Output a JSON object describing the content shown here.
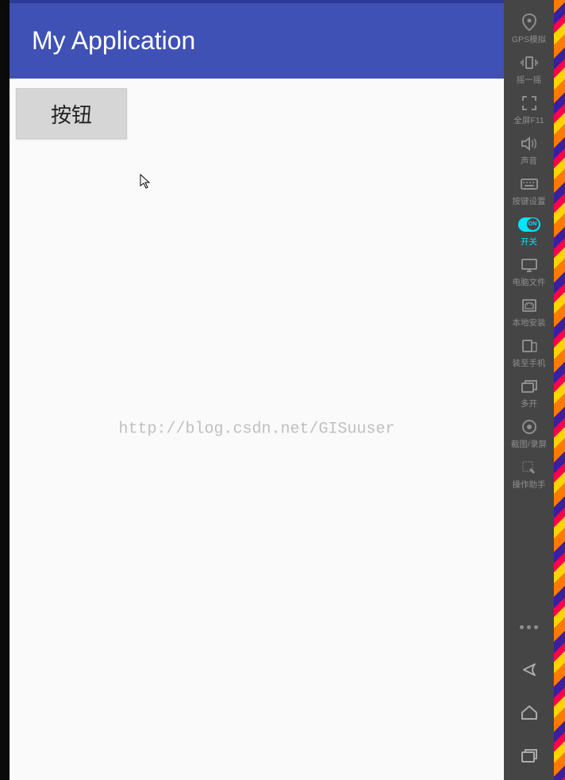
{
  "app": {
    "title": "My Application",
    "button_label": "按钮"
  },
  "watermark": "http://blog.csdn.net/GISuuser",
  "sidebar": {
    "items": [
      {
        "id": "gps",
        "label": "GPS模拟",
        "active": false
      },
      {
        "id": "shake",
        "label": "摇一摇",
        "active": false
      },
      {
        "id": "fullscreen",
        "label": "全屏F11",
        "active": false
      },
      {
        "id": "sound",
        "label": "声音",
        "active": false
      },
      {
        "id": "keymap",
        "label": "按键设置",
        "active": false
      },
      {
        "id": "switch",
        "label": "开关",
        "active": true
      },
      {
        "id": "pcfile",
        "label": "电脑文件",
        "active": false
      },
      {
        "id": "localinstall",
        "label": "本地安装",
        "active": false
      },
      {
        "id": "tophone",
        "label": "装至手机",
        "active": false
      },
      {
        "id": "multi",
        "label": "多开",
        "active": false
      },
      {
        "id": "capture",
        "label": "截图/录屏",
        "active": false
      },
      {
        "id": "assist",
        "label": "操作助手",
        "active": false
      }
    ]
  }
}
